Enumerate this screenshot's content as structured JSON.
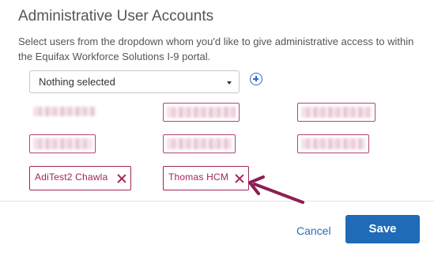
{
  "dialog": {
    "title": "Administrative User Accounts",
    "description": "Select users from the dropdown whom you'd like to give administrative access to within the Equifax Workforce Solutions I-9 portal."
  },
  "user_select": {
    "value": "Nothing selected"
  },
  "chips": [
    {
      "label": "AdiTest2 Chawla"
    },
    {
      "label": "Thomas HCM"
    }
  ],
  "footer": {
    "cancel_label": "Cancel",
    "save_label": "Save"
  },
  "colors": {
    "chip_accent": "#a1245a",
    "primary": "#1f6bb8",
    "link": "#2a6cc4",
    "annotation_arrow": "#8c1f55"
  },
  "icons": [
    "chevron-down-icon",
    "add-circle-icon",
    "close-icon",
    "annotation-arrow"
  ]
}
